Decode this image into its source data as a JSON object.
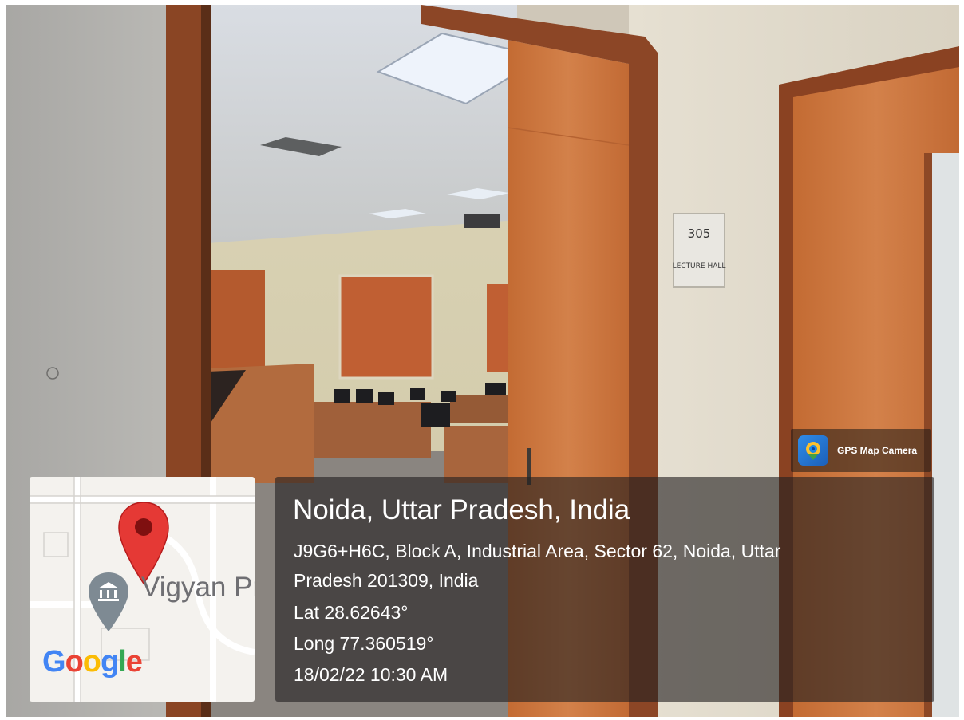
{
  "photo": {
    "room_sign": {
      "number": "305",
      "label": "LECTURE HALL"
    }
  },
  "app_badge": {
    "icon": "gps-map-camera-icon",
    "label": "GPS Map Camera"
  },
  "location": {
    "title": "Noida, Uttar Pradesh, India",
    "address_line_1": "J9G6+H6C, Block A, Industrial Area, Sector 62, Noida, Uttar",
    "address_line_2": "Pradesh 201309, India",
    "latitude": "Lat 28.62643°",
    "longitude": "Long 77.360519°",
    "datetime": "18/02/22 10:30 AM"
  },
  "map_thumbnail": {
    "place_label": "Vigyan Pr",
    "place_icon": "museum-icon",
    "pin_icon": "map-pin-icon",
    "logo": {
      "G": "G",
      "o1": "o",
      "o2": "o",
      "g": "g",
      "l": "l",
      "e": "e"
    }
  },
  "colors": {
    "pin_red": "#e53935",
    "door_orange": "#c9733a",
    "google_blue": "#4285f4",
    "google_red": "#ea4335",
    "google_yellow": "#fbbc05",
    "google_green": "#34a853"
  }
}
